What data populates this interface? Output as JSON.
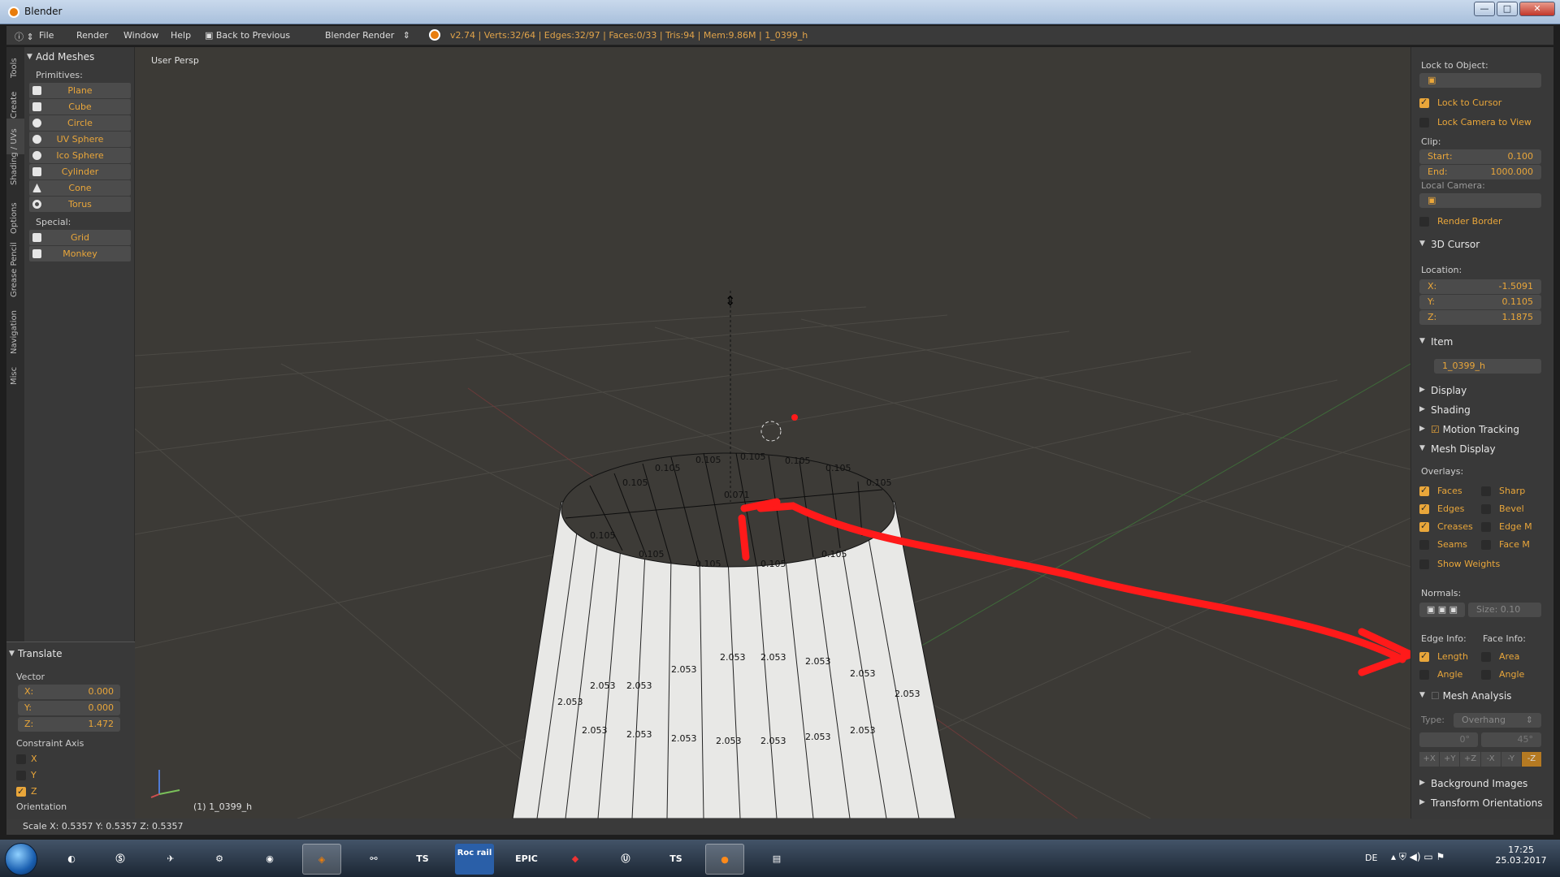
{
  "window": {
    "title": "Blender",
    "min": "—",
    "max": "□",
    "close": "✕"
  },
  "info": {
    "menus": [
      "File",
      "Render",
      "Window",
      "Help"
    ],
    "back": "Back to Previous",
    "engine": "Blender Render",
    "stats": "v2.74 | Verts:32/64 | Edges:32/97 | Faces:0/33 | Tris:94 | Mem:9.86M | 1_0399_h"
  },
  "tabs": [
    "Tools",
    "Create",
    "Shading / UVs",
    "Options",
    "Grease Pencil",
    "Navigation",
    "Misc"
  ],
  "toolshelf": {
    "title": "Add Meshes",
    "primitives_label": "Primitives:",
    "primitives": [
      "Plane",
      "Cube",
      "Circle",
      "UV Sphere",
      "Ico Sphere",
      "Cylinder",
      "Cone",
      "Torus"
    ],
    "special_label": "Special:",
    "special": [
      "Grid",
      "Monkey"
    ]
  },
  "operator": {
    "title": "Translate",
    "vector_label": "Vector",
    "x_label": "X:",
    "x_value": "0.000",
    "y_label": "Y:",
    "y_value": "0.000",
    "z_label": "Z:",
    "z_value": "1.472",
    "constraint_label": "Constraint Axis",
    "axes": [
      "X",
      "Y",
      "Z"
    ],
    "orientation_label": "Orientation"
  },
  "viewport": {
    "view_label": "User Persp",
    "object_label": "(1) 1_0399_h",
    "rim_labels": [
      "0.105",
      "0.071"
    ],
    "side_label": "2.053",
    "colors": {
      "background": "#3c3a36",
      "grid": "#4a4843",
      "mesh": "#e8e8e6",
      "annotation": "#ff1a1a"
    }
  },
  "properties": {
    "lock_to_object": "Lock to Object:",
    "lock_to_cursor": "Lock to Cursor",
    "lock_camera": "Lock Camera to View",
    "clip": "Clip:",
    "start_label": "Start:",
    "start_value": "0.100",
    "end_label": "End:",
    "end_value": "1000.000",
    "local_camera": "Local Camera:",
    "render_border": "Render Border",
    "cursor_title": "3D Cursor",
    "location": "Location:",
    "cx_label": "X:",
    "cx_value": "-1.5091",
    "cy_label": "Y:",
    "cy_value": "0.1105",
    "cz_label": "Z:",
    "cz_value": "1.1875",
    "item_title": "Item",
    "item_name": "1_0399_h",
    "display": "Display",
    "shading": "Shading",
    "motion_tracking": "Motion Tracking",
    "mesh_display": "Mesh Display",
    "overlays": "Overlays:",
    "ov_faces": "Faces",
    "ov_sharp": "Sharp",
    "ov_edges": "Edges",
    "ov_bevel": "Bevel",
    "ov_creases": "Creases",
    "ov_edgem": "Edge M",
    "ov_seams": "Seams",
    "ov_facem": "Face M",
    "show_weights": "Show Weights",
    "normals": "Normals:",
    "normal_size": "Size:  0.10",
    "edge_info": "Edge Info:",
    "face_info": "Face Info:",
    "length": "Length",
    "area": "Area",
    "angle1": "Angle",
    "angle2": "Angle",
    "mesh_analysis": "Mesh Analysis",
    "type_label": "Type:",
    "type_value": "Overhang",
    "deg0": "0°",
    "deg45": "45°",
    "axes": [
      "+X",
      "+Y",
      "+Z",
      "-X",
      "-Y",
      "-Z"
    ],
    "background_images": "Background Images",
    "transform_orientations": "Transform Orientations"
  },
  "status": "Scale X: 0.5357   Y: 0.5357   Z: 0.5357",
  "taskbar": {
    "apps": [
      "TS",
      "Roc rail",
      "EPIC",
      "TS"
    ],
    "lang": "DE",
    "time": "17:25",
    "date": "25.03.2017"
  }
}
